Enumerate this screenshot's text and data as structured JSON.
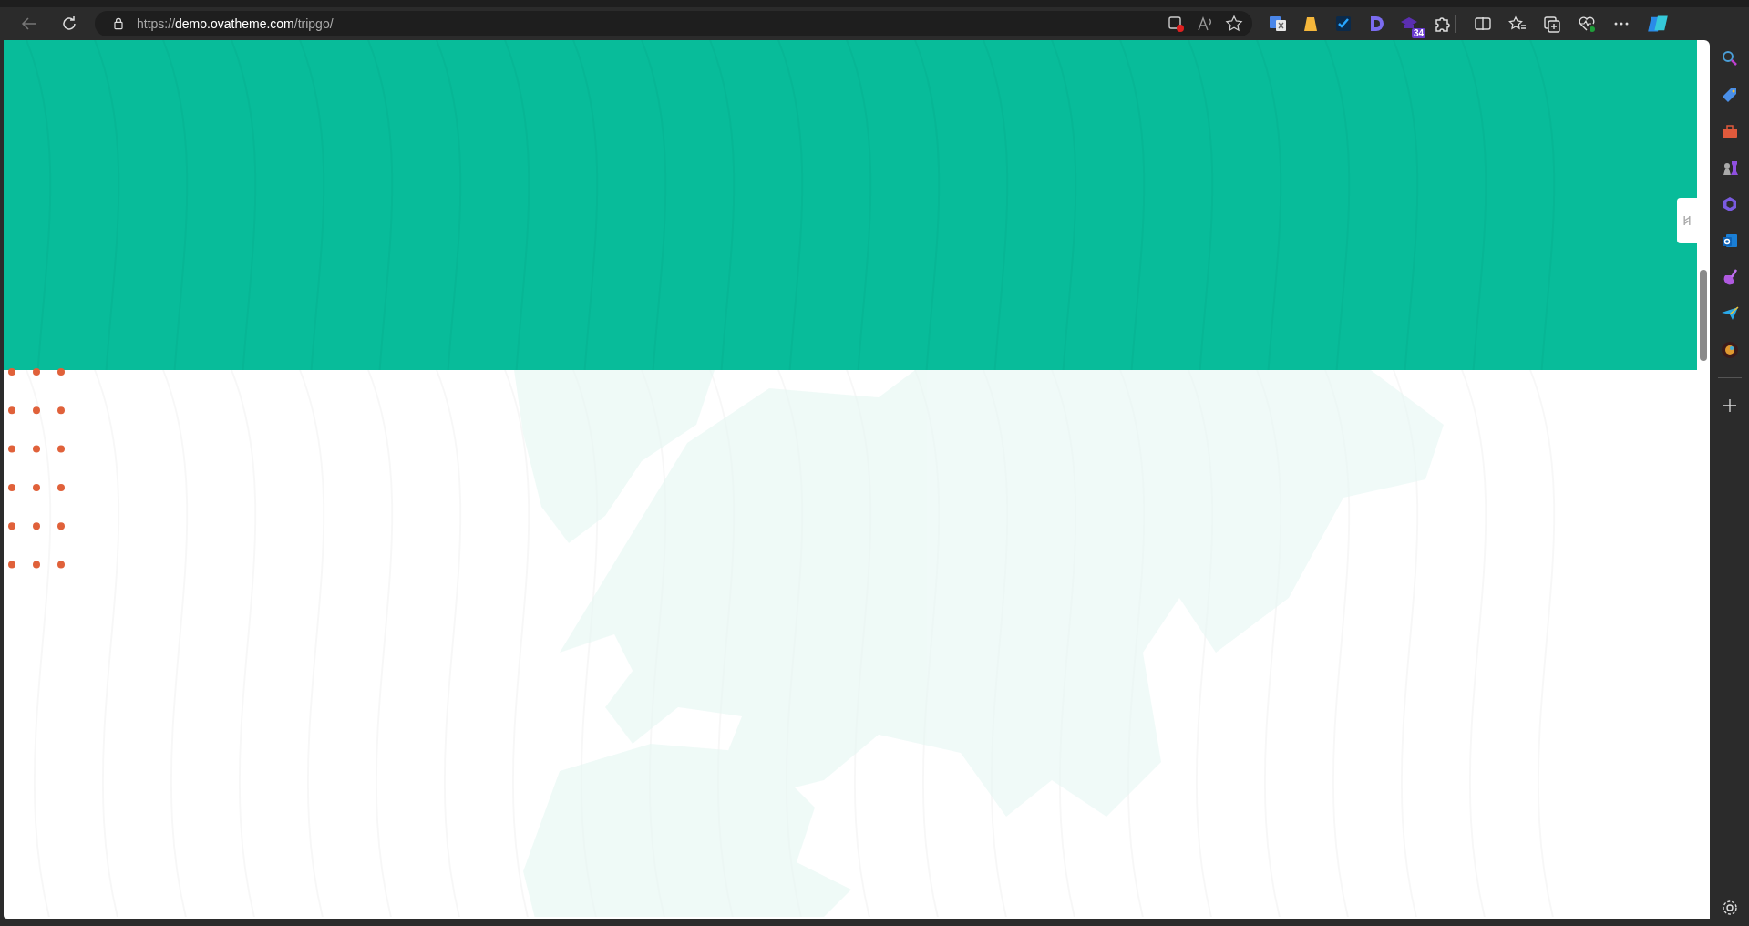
{
  "browser": {
    "url_scheme": "https://",
    "url_host": "demo.ovatheme.com",
    "url_path": "/tripgo/"
  },
  "extensions": [
    {
      "kind": "translate"
    },
    {
      "kind": "bag"
    },
    {
      "kind": "check"
    },
    {
      "kind": "logo"
    },
    {
      "kind": "cap",
      "badge": "34"
    },
    {
      "kind": "puzzle"
    }
  ]
}
